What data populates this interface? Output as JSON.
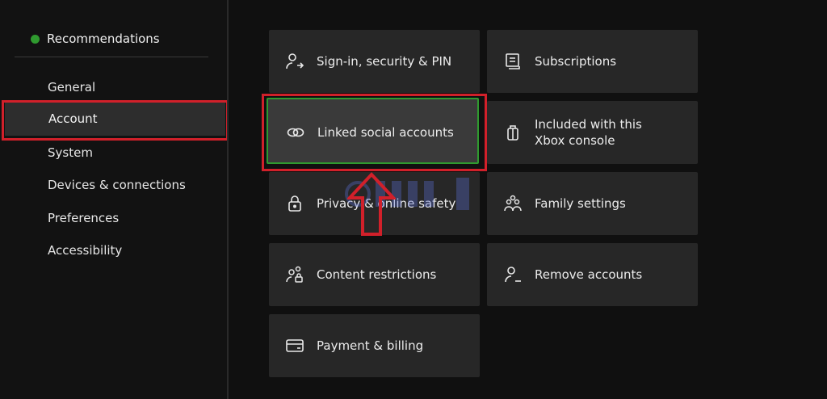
{
  "sidebar": {
    "recommendations_label": "Recommendations",
    "items": [
      {
        "label": "General"
      },
      {
        "label": "Account"
      },
      {
        "label": "System"
      },
      {
        "label": "Devices & connections"
      },
      {
        "label": "Preferences"
      },
      {
        "label": "Accessibility"
      }
    ],
    "selected_item": "Account"
  },
  "tiles": [
    {
      "label": "Sign-in, security & PIN",
      "icon": "person-key-icon"
    },
    {
      "label": "Subscriptions",
      "icon": "subscription-list-icon"
    },
    {
      "label": "Linked social accounts",
      "icon": "link-icon"
    },
    {
      "label": "Included with this Xbox console",
      "icon": "gift-icon"
    },
    {
      "label": "Privacy & online safety",
      "icon": "lock-icon"
    },
    {
      "label": "Family settings",
      "icon": "family-icon"
    },
    {
      "label": "Content restrictions",
      "icon": "person-lock-icon"
    },
    {
      "label": "Remove accounts",
      "icon": "person-remove-icon"
    },
    {
      "label": "Payment & billing",
      "icon": "credit-card-icon"
    }
  ],
  "focused_tile": "Linked social accounts",
  "colors": {
    "background": "#101010",
    "tile": "#272727",
    "tile_focused": "#3a3a3a",
    "focus_border": "#2f9a2f",
    "annotation_red": "#d1202a",
    "status_dot": "#2f9a2f"
  }
}
